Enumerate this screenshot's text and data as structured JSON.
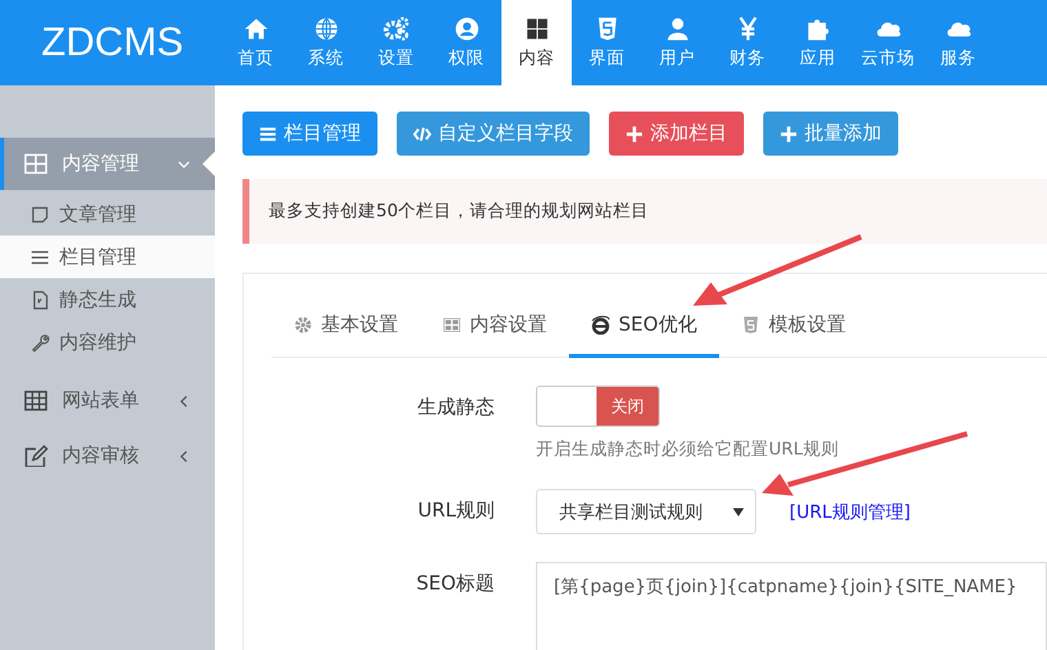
{
  "logo": "ZDCMS",
  "nav": [
    {
      "label": "首页",
      "selected": false
    },
    {
      "label": "系统",
      "selected": false
    },
    {
      "label": "设置",
      "selected": false
    },
    {
      "label": "权限",
      "selected": false
    },
    {
      "label": "内容",
      "selected": true
    },
    {
      "label": "界面",
      "selected": false
    },
    {
      "label": "用户",
      "selected": false
    },
    {
      "label": "财务",
      "selected": false
    },
    {
      "label": "应用",
      "selected": false
    },
    {
      "label": "云市场",
      "selected": false
    },
    {
      "label": "服务",
      "selected": false
    }
  ],
  "sidebar": {
    "groups": [
      {
        "label": "内容管理",
        "expanded": true,
        "selected": true,
        "children": [
          {
            "label": "文章管理",
            "selected": false
          },
          {
            "label": "栏目管理",
            "selected": true
          },
          {
            "label": "静态生成",
            "selected": false
          },
          {
            "label": "内容维护",
            "selected": false
          }
        ]
      },
      {
        "label": "网站表单",
        "expanded": false,
        "selected": false
      },
      {
        "label": "内容审核",
        "expanded": false,
        "selected": false
      }
    ]
  },
  "buttons": [
    {
      "label": "栏目管理",
      "kind": "primary"
    },
    {
      "label": "自定义栏目字段",
      "kind": "info"
    },
    {
      "label": "添加栏目",
      "kind": "danger"
    },
    {
      "label": "批量添加",
      "kind": "info"
    }
  ],
  "alert": "最多支持创建50个栏目，请合理的规划网站栏目",
  "tabs": [
    {
      "label": "基本设置",
      "selected": false
    },
    {
      "label": "内容设置",
      "selected": false
    },
    {
      "label": "SEO优化",
      "selected": true
    },
    {
      "label": "模板设置",
      "selected": false
    }
  ],
  "form": [
    {
      "kind": "toggle",
      "label": "生成静态",
      "on": false,
      "state_text": "关闭",
      "help": "开启生成静态时必须给它配置URL规则"
    },
    {
      "kind": "select",
      "label": "URL规则",
      "value": "共享栏目测试规则",
      "link": "[URL规则管理]"
    },
    {
      "kind": "textarea",
      "label": "SEO标题",
      "value": "[第{page}页{join}]{catpname}{join}{SITE_NAME}"
    }
  ]
}
